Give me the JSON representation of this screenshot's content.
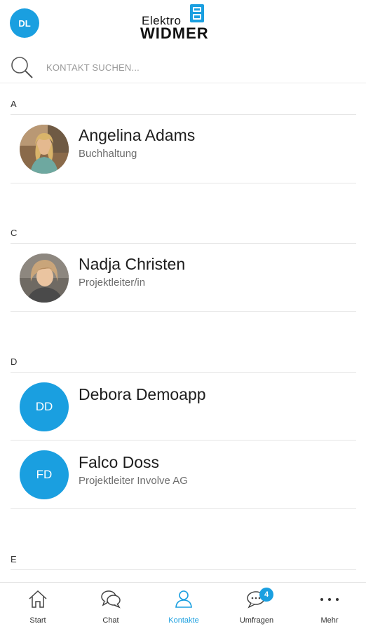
{
  "header": {
    "user_initials": "DL",
    "logo_line1": "Elektro",
    "logo_line2": "WIDMER"
  },
  "search": {
    "placeholder": "KONTAKT SUCHEN..."
  },
  "sections": [
    {
      "letter": "A",
      "contacts": [
        {
          "name": "Angelina Adams",
          "role": "Buchhaltung",
          "avatar": "photo"
        }
      ]
    },
    {
      "letter": "C",
      "contacts": [
        {
          "name": "Nadja Christen",
          "role": "Projektleiter/in",
          "avatar": "photo"
        }
      ]
    },
    {
      "letter": "D",
      "contacts": [
        {
          "name": "Debora Demoapp",
          "role": "",
          "avatar": "initials",
          "initials": "DD"
        },
        {
          "name": "Falco Doss",
          "role": "Projektleiter Involve AG",
          "avatar": "initials",
          "initials": "FD"
        }
      ]
    },
    {
      "letter": "E",
      "contacts": []
    }
  ],
  "bottom_nav": {
    "items": [
      {
        "label": "Start",
        "icon": "home-icon",
        "active": false
      },
      {
        "label": "Chat",
        "icon": "chat-icon",
        "active": false
      },
      {
        "label": "Kontakte",
        "icon": "contacts-icon",
        "active": true
      },
      {
        "label": "Umfragen",
        "icon": "survey-icon",
        "active": false,
        "badge": "4"
      },
      {
        "label": "Mehr",
        "icon": "more-icon",
        "active": false
      }
    ]
  },
  "colors": {
    "accent": "#1a9fe0",
    "text_primary": "#1d1d1d",
    "text_secondary": "#6d6d6d",
    "divider": "#e6e6e6"
  }
}
